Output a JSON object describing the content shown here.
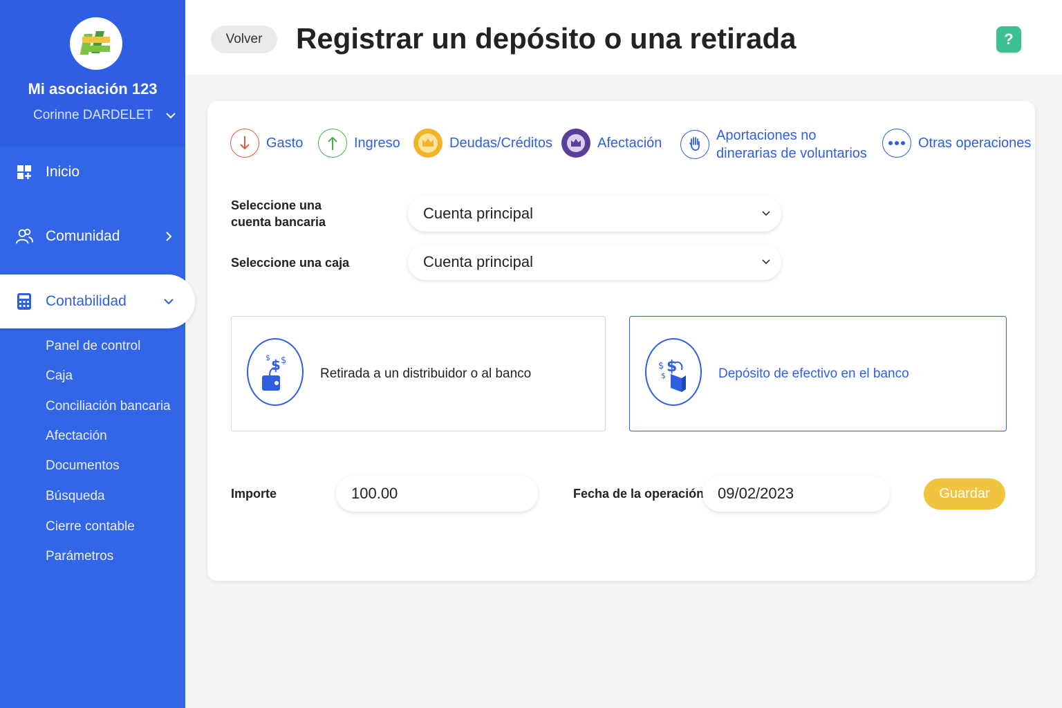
{
  "sidebar": {
    "org_name": "Mi asociación 123",
    "user_name": "Corinne DARDELET",
    "nav": [
      {
        "label": "Inicio",
        "icon": "dashboard-icon"
      },
      {
        "label": "Comunidad",
        "icon": "users-icon"
      },
      {
        "label": "Contabilidad",
        "icon": "calculator-icon"
      }
    ],
    "sub_items": [
      "Panel de control",
      "Caja",
      "Conciliación bancaria",
      "Afectación",
      "Documentos",
      "Búsqueda",
      "Cierre contable",
      "Parámetros"
    ]
  },
  "header": {
    "back_label": "Volver",
    "title": "Registrar un depósito o una retirada",
    "help_label": "?"
  },
  "tabs": [
    {
      "label": "Gasto",
      "icon": "arrow-down-icon",
      "color": "#e05a3c"
    },
    {
      "label": "Ingreso",
      "icon": "arrow-up-icon",
      "color": "#4caf50"
    },
    {
      "label": "Deudas/Créditos",
      "icon": "crown-icon",
      "color": "#f0b429"
    },
    {
      "label": "Afectación",
      "icon": "crown-arrows-icon",
      "color": "#5b3e96"
    },
    {
      "label_line1": "Aportaciones no",
      "label_line2": "dinerarias de voluntarios",
      "icon": "hand-icon",
      "color": "#2f5ee3"
    },
    {
      "label": "Otras operaciones",
      "icon": "more-icon",
      "color": "#2f5ee3"
    }
  ],
  "form": {
    "bank_label_line1": "Seleccione una",
    "bank_label_line2": "cuenta bancaria",
    "bank_value": "Cuenta principal",
    "cash_label": "Seleccione una caja",
    "cash_value": "Cuenta principal"
  },
  "operations": [
    {
      "label": "Retirada a un distribuidor o al banco",
      "icon": "withdrawal-icon",
      "selected": false
    },
    {
      "label": "Depósito de efectivo en el banco",
      "icon": "deposit-icon",
      "selected": true
    }
  ],
  "amount": {
    "label": "Importe",
    "value": "100.00"
  },
  "date": {
    "label": "Fecha de la operación",
    "value": "09/02/2023"
  },
  "save_label": "Guardar",
  "colors": {
    "primary": "#2f5ee3",
    "sidebar": "#3366e6",
    "accent": "#f0c340",
    "help": "#3dbf96"
  }
}
